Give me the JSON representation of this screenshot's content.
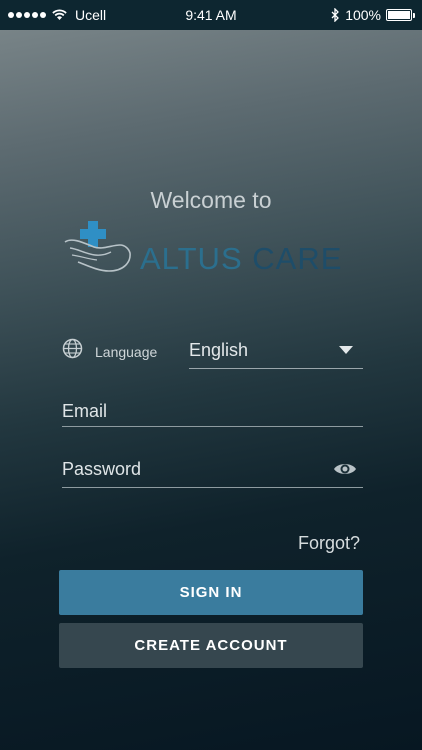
{
  "status_bar": {
    "carrier": "Ucell",
    "time": "9:41 AM",
    "battery": "100%"
  },
  "welcome": "Welcome to",
  "logo": {
    "word1": "ALTUS",
    "word2": "CARE"
  },
  "language": {
    "label": "Language",
    "value": "English"
  },
  "email": {
    "placeholder": "Email"
  },
  "password": {
    "placeholder": "Password"
  },
  "forgot": "Forgot?",
  "buttons": {
    "sign_in": "SIGN IN",
    "create_account": "CREATE ACCOUNT"
  },
  "colors": {
    "primary": "#3a7c9e",
    "secondary": "#36474f",
    "status_bar": "#0d2630"
  },
  "icons": {
    "language": "globe-icon",
    "password_toggle": "eye-icon"
  }
}
